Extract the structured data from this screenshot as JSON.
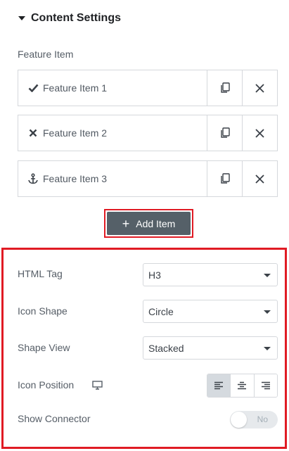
{
  "section": {
    "title": "Content Settings",
    "icon": "caret-down-icon"
  },
  "repeater": {
    "label": "Feature Item",
    "items": [
      {
        "icon": "check-icon",
        "title": "Feature Item 1"
      },
      {
        "icon": "times-icon",
        "title": "Feature Item 2"
      },
      {
        "icon": "anchor-icon",
        "title": "Feature Item 3"
      }
    ],
    "add_label": "Add Item"
  },
  "settings": {
    "html_tag": {
      "label": "HTML Tag",
      "value": "H3"
    },
    "icon_shape": {
      "label": "Icon Shape",
      "value": "Circle"
    },
    "shape_view": {
      "label": "Shape View",
      "value": "Stacked"
    },
    "icon_position": {
      "label": "Icon Position",
      "options": [
        "left",
        "center",
        "right"
      ],
      "selected": "left"
    },
    "show_connector": {
      "label": "Show Connector",
      "state_label": "No",
      "enabled": false
    }
  },
  "colors": {
    "highlight": "#e01b24",
    "button_bg": "#556068"
  }
}
